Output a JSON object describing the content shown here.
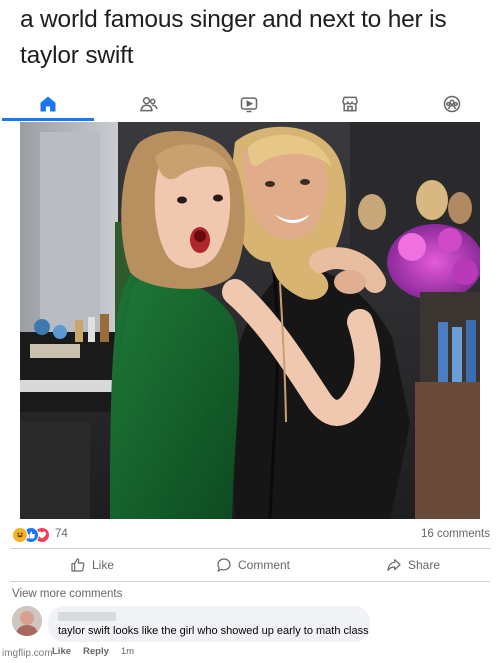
{
  "post": {
    "caption": "a world famous singer and next to her is taylor swift"
  },
  "nav": {
    "tabs": [
      {
        "name": "home",
        "icon": "home-icon",
        "active": true
      },
      {
        "name": "friends",
        "icon": "friends-icon",
        "active": false
      },
      {
        "name": "video",
        "icon": "video-icon",
        "active": false
      },
      {
        "name": "marketplace",
        "icon": "marketplace-icon",
        "active": false
      },
      {
        "name": "groups",
        "icon": "groups-icon",
        "active": false
      }
    ],
    "active_color": "#1877f2",
    "inactive_color": "#65676b"
  },
  "reactions": {
    "icons": [
      "haha-icon",
      "like-icon",
      "love-icon"
    ],
    "count": "74",
    "comments_count": "16 comments"
  },
  "actions": {
    "like_label": "Like",
    "comment_label": "Comment",
    "share_label": "Share"
  },
  "comments": {
    "view_more_label": "View more comments",
    "items": [
      {
        "text": "taylor swift looks like the girl who showed up early to math class",
        "like_label": "Like",
        "reply_label": "Reply",
        "time": "1m"
      }
    ]
  },
  "watermark": "imgflip.com"
}
